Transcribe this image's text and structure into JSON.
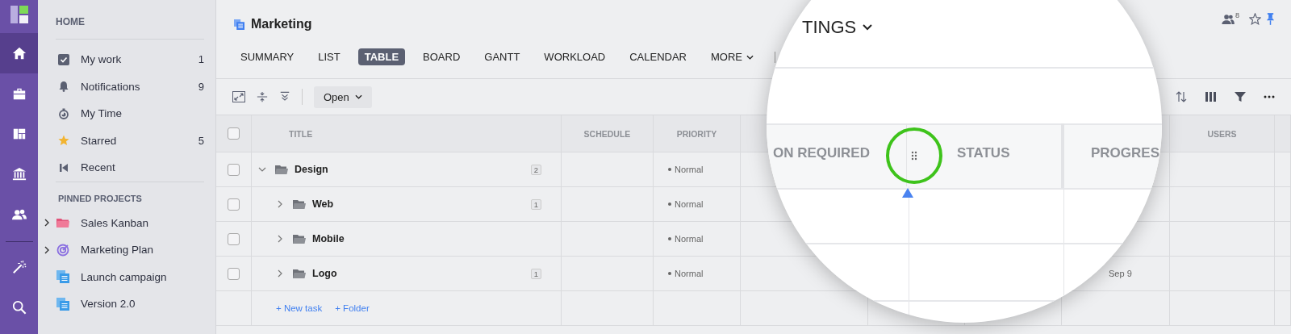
{
  "rail": [
    {
      "kind": "home",
      "selected": true
    },
    {
      "kind": "briefcase",
      "selected": false
    },
    {
      "kind": "board",
      "selected": false
    },
    {
      "kind": "bank",
      "selected": false
    },
    {
      "kind": "people",
      "selected": false
    },
    {
      "kind": "wand",
      "selected": false
    },
    {
      "kind": "search",
      "selected": false
    }
  ],
  "sidebar": {
    "heading": "HOME",
    "items": [
      {
        "label": "My work",
        "count": "1",
        "kind": "check"
      },
      {
        "label": "Notifications",
        "count": "9",
        "kind": "bell"
      },
      {
        "label": "My Time",
        "kind": "timer"
      },
      {
        "label": "Starred",
        "count": "5",
        "kind": "star"
      },
      {
        "label": "Recent",
        "kind": "recent"
      }
    ],
    "pinned_heading": "PINNED PROJECTS",
    "pinned": [
      {
        "label": "Sales Kanban",
        "kind": "folder",
        "expandable": true
      },
      {
        "label": "Marketing Plan",
        "kind": "target",
        "expandable": true
      },
      {
        "label": "Launch campaign",
        "kind": "doc",
        "expandable": false
      },
      {
        "label": "Version 2.0",
        "kind": "doc",
        "expandable": false
      }
    ]
  },
  "header": {
    "title": "Marketing",
    "followers": "8"
  },
  "tabs": [
    {
      "label": "SUMMARY",
      "selected": false
    },
    {
      "label": "LIST",
      "selected": false
    },
    {
      "label": "TABLE",
      "selected": true
    },
    {
      "label": "BOARD",
      "selected": false
    },
    {
      "label": "GANTT",
      "selected": false
    },
    {
      "label": "WORKLOAD",
      "selected": false
    },
    {
      "label": "CALENDAR",
      "selected": false
    },
    {
      "label": "MORE",
      "selected": false
    }
  ],
  "toolbar": {
    "filter": "Open"
  },
  "table": {
    "all_checked": false,
    "columns": [
      "TITLE",
      "SCHEDULE",
      "PRIORITY",
      "USERS"
    ],
    "rows": [
      {
        "title": "Design",
        "count": "2",
        "priority": "Normal",
        "expanded": true,
        "checked": false,
        "children": [
          {
            "title": "Web",
            "count": "1",
            "priority": "Normal",
            "expanded": false,
            "checked": false
          },
          {
            "title": "Mobile",
            "priority": "Normal",
            "expanded": false,
            "checked": false
          },
          {
            "title": "Logo",
            "count": "1",
            "priority": "Normal",
            "expanded": false,
            "checked": false,
            "column_7": "Sep 9"
          }
        ]
      }
    ],
    "add_links": [
      "+ New task",
      "+ Folder"
    ]
  },
  "magnifier": {
    "tab": "TINGS",
    "columns": [
      "ON REQUIRED",
      "STATUS",
      "PROGRES"
    ]
  }
}
